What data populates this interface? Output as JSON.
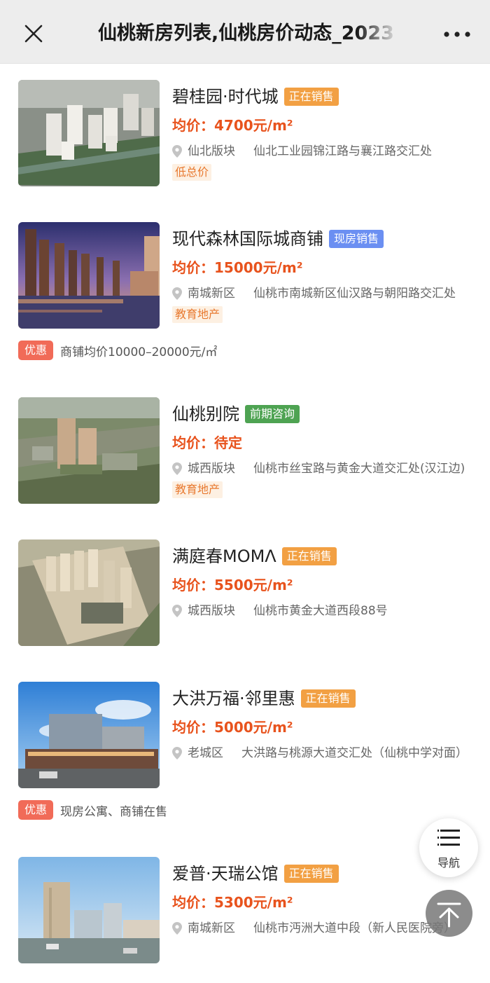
{
  "header": {
    "title": "仙桃新房列表,仙桃房价动态_2023",
    "close_icon": "close-icon",
    "more_icon": "more-dots-icon"
  },
  "listings": [
    {
      "name": "碧桂园·时代城",
      "status": "正在销售",
      "status_color": "#f2a043",
      "price": "均价：4700元/m²",
      "district": "仙北版块",
      "address": "仙北工业园锦江路与襄江路交汇处",
      "tag": "低总价"
    },
    {
      "name": "现代森林国际城商铺",
      "status": "现房销售",
      "status_color": "#6b8ff2",
      "price": "均价：15000元/m²",
      "district": "南城新区",
      "address": "仙桃市南城新区仙汉路与朝阳路交汇处",
      "tag": "教育地产",
      "promo_badge": "优惠",
      "promo_text": "商铺均价10000–20000元/㎡"
    },
    {
      "name": "仙桃别院",
      "status": "前期咨询",
      "status_color": "#4ea352",
      "price": "均价：待定",
      "district": "城西版块",
      "address": "仙桃市丝宝路与黄金大道交汇处(汉江边)",
      "tag": "教育地产"
    },
    {
      "name": "满庭春MOMΛ",
      "status": "正在销售",
      "status_color": "#f2a043",
      "price": "均价：5500元/m²",
      "district": "城西版块",
      "address": "仙桃市黄金大道西段88号"
    },
    {
      "name": "大洪万福·邻里惠",
      "status": "正在销售",
      "status_color": "#f2a043",
      "price": "均价：5000元/m²",
      "district": "老城区",
      "address": "大洪路与桃源大道交汇处（仙桃中学对面）",
      "promo_badge": "优惠",
      "promo_text": "现房公寓、商铺在售"
    },
    {
      "name": "爱普·天瑞公馆",
      "status": "正在销售",
      "status_color": "#f2a043",
      "price": "均价：5300元/m²",
      "district": "南城新区",
      "address": "仙桃市沔洲大道中段（新人民医院旁）"
    }
  ],
  "float": {
    "nav_label": "导航",
    "nav_icon": "menu-lines-icon",
    "top_icon": "back-to-top-icon"
  },
  "colors": {
    "price": "#e8531d",
    "tag_text": "#e8792f",
    "tag_bg": "#fdf0e2",
    "promo_badge": "#f16b58"
  }
}
